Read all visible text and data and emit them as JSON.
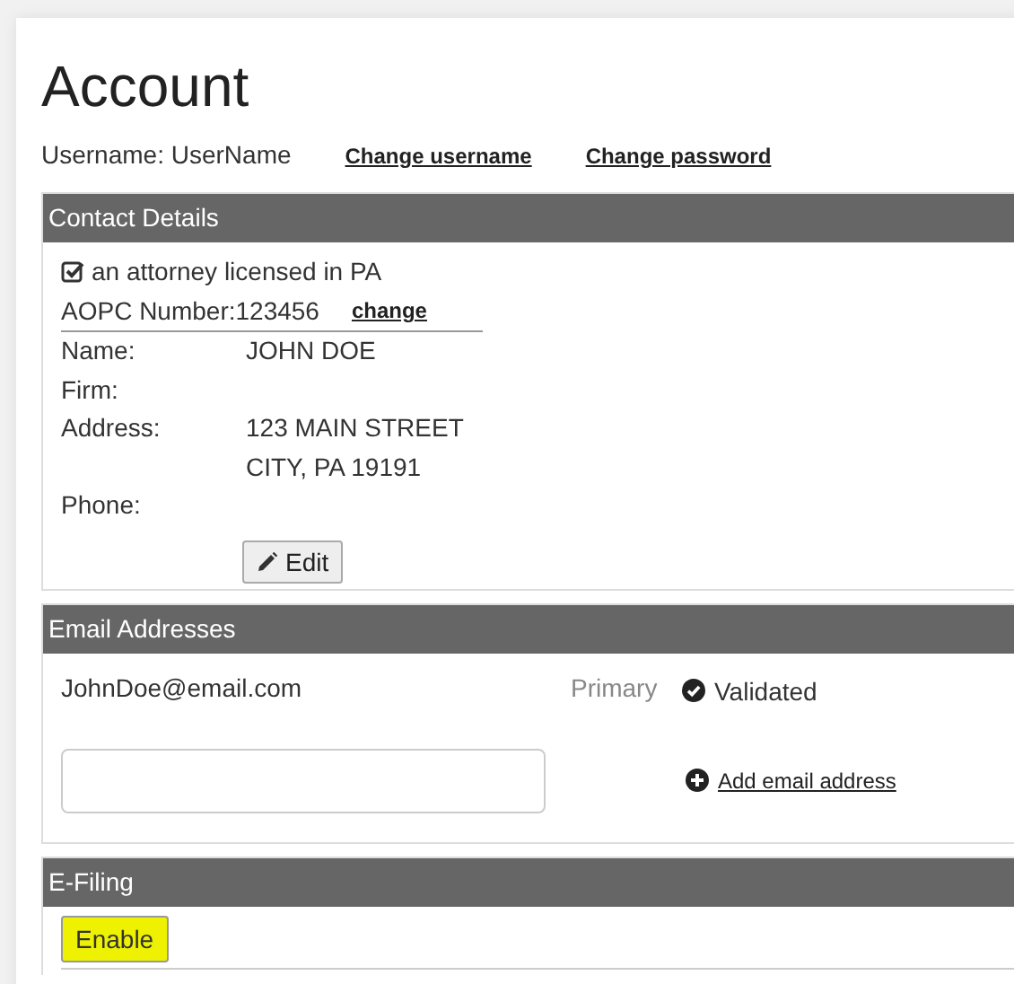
{
  "title": "Account",
  "username": {
    "label": "Username: UserName",
    "links": [
      "Change username",
      "Change password"
    ]
  },
  "contact": {
    "header": "Contact Details",
    "attorney": {
      "label": "an attorney licensed in PA",
      "checked": true
    },
    "aopc": {
      "label": "AOPC Number:123456",
      "link": "change"
    },
    "fields": [
      {
        "label": "Name:",
        "values": [
          "JOHN DOE"
        ]
      },
      {
        "label": "Firm:"
      },
      {
        "label": "Address:",
        "values": [
          "123 MAIN STREET",
          "CITY, PA 19191"
        ]
      },
      {
        "label": "Phone:"
      }
    ],
    "edit_button": "Edit"
  },
  "email": {
    "header": "Email Addresses",
    "addresses": [
      {
        "address": "JohnDoe@email.com",
        "primary": "Primary",
        "status": "Validated",
        "validated": true
      }
    ],
    "add_link": "Add email address"
  },
  "efiling": {
    "header": "E-Filing",
    "button": {
      "label": "Enable",
      "highlighted": true
    }
  }
}
